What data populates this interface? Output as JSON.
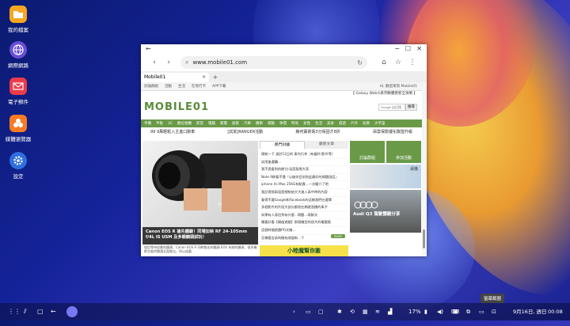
{
  "desktop_icons": [
    {
      "label": "我的檔案",
      "color": "#f5a623"
    },
    {
      "label": "網際網路",
      "color": "#6a4fd6"
    },
    {
      "label": "電子郵件",
      "color": "#ea3b4b"
    },
    {
      "label": "媒體瀏覽器",
      "color": "#f57c25"
    },
    {
      "label": "設定",
      "color": "#2f6fe0"
    }
  ],
  "browser": {
    "url": "www.mobile01.com",
    "tab_title": "Mobile01",
    "new_tab": "+",
    "page": {
      "topnav": [
        "討論群組",
        "活動",
        "生活",
        "在地行卡",
        "APP下載"
      ],
      "login_text": "Hi, 歡迎來到 Mobile01",
      "logo": "MOBILE01",
      "search_placeholder": "Google 自訂搜",
      "search_button": "搜尋",
      "promo": "【 Galaxy Watch系列軟體更新全攻略 】",
      "categories": [
        "手機",
        "平板",
        "3C",
        "數位相機",
        "影音",
        "電腦",
        "家電",
        "居家",
        "汽車",
        "機車",
        "運動",
        "休閒",
        "時尚",
        "女性",
        "生活",
        "美食",
        "旅遊",
        "戶外",
        "投資",
        "大宇宙"
      ],
      "headlines": [
        "99 9萬輕鬆入主進口跑車",
        "[試駕]RANGER活動",
        "幾何寶貴電3分保固才8折",
        "兩雲保險優化聯盟升級"
      ],
      "hero_caption": "Canon EOS R 搶先體驗！同場加映 RF 24-105mm f/4L IS USM 及多顆鏡頭試玩！",
      "hero_sub": "相信等待對應的鏡頭，Canon EOS R 同時推出的鏡頭 EOS 系統的鏡頭，很多攝影生能的鏡頭全面推出，所以這篇",
      "forum_tabs": [
        "熱門討論",
        "最新文章"
      ],
      "forum_items": [
        "總統一下 週討12日的 車內行李（有圖片/影片等）",
        "試用後選購...",
        "我不過看到的期刊-深度發覺大家",
        "Note 9刷看不懂『以後你目前到此最好的問題說話』",
        "iphone Xs Max 256G有點貴...一次簡介了吧",
        "我記得那兩屆是總統給大大進入高中時的內容",
        "看得不要Google和Facebook的這樣我們在選擇",
        "多個影片的片段大部分都拍在網遊直播的車子",
        "如果有人寫信到有什麼...問題...再解決",
        "應要好看【開啟遊戲】那個機型的很大的電腦版",
        "這個時間遊戲PO文機...",
        "怎樣要告訴的開始改變新...下"
      ],
      "more_label": "more",
      "side_cards": [
        "討論群組",
        "參加活動",
        "桌機",
        "Audi Q3 駕駛體驗分享"
      ],
      "bottom_banner": "小睦魔幫你搬"
    }
  },
  "taskbar": {
    "battery": "17%",
    "date": "9月16日, 週日",
    "time": "00:08",
    "tooltip": "螢幕截圖"
  }
}
